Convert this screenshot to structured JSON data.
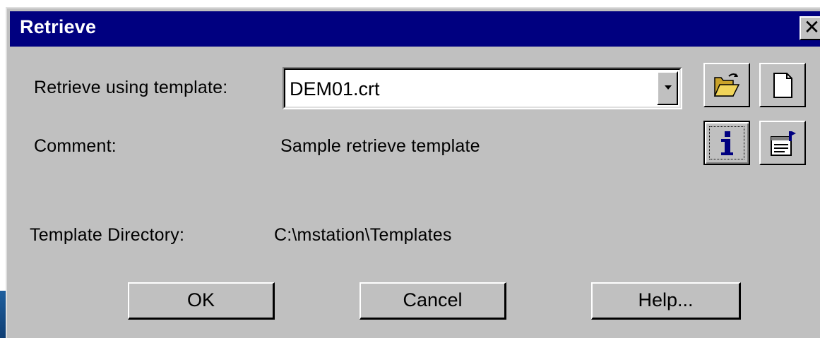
{
  "window": {
    "title": "Retrieve",
    "close_glyph": "✕"
  },
  "form": {
    "template_label": "Retrieve using template:",
    "template_value": "DEM01.crt",
    "comment_label": "Comment:",
    "comment_value": "Sample retrieve template",
    "directory_label": "Template Directory:",
    "directory_value": "C:\\mstation\\Templates"
  },
  "toolbar": {
    "open_icon": "open-folder-icon",
    "new_icon": "new-document-icon",
    "info_icon": "info-icon",
    "properties_icon": "properties-icon"
  },
  "buttons": {
    "ok": "OK",
    "cancel": "Cancel",
    "help": "Help..."
  },
  "colors": {
    "titlebar": "#000080",
    "face": "#c0c0c0",
    "folder": "#e8c64a"
  }
}
